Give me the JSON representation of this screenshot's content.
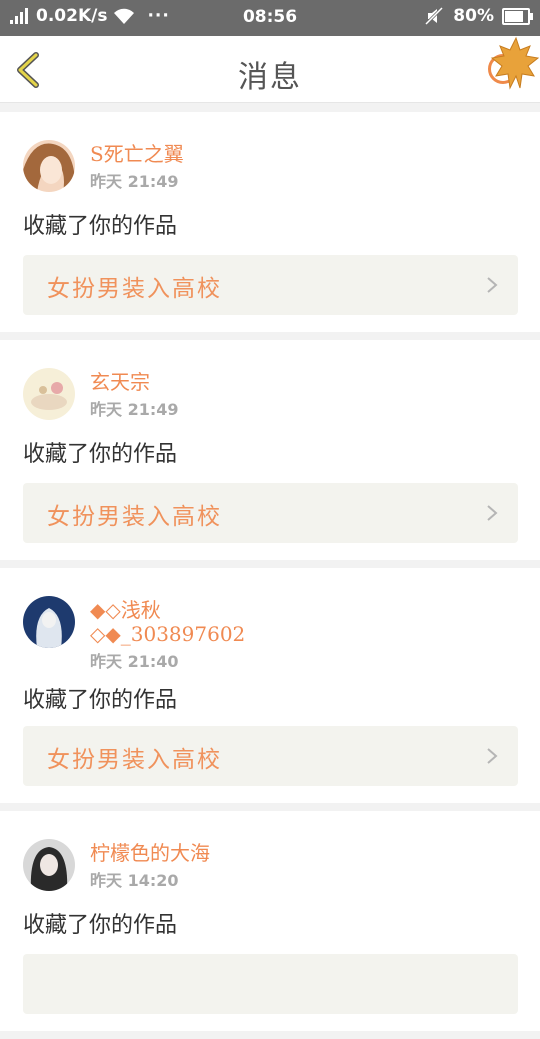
{
  "status_bar": {
    "network_speed": "0.02K/s",
    "more": "···",
    "time": "08:56",
    "battery_percent": "80%",
    "battery_level": 0.8
  },
  "header": {
    "title": "消息",
    "accent_color": "#ef8a4a"
  },
  "messages": [
    {
      "user": "S死亡之翼",
      "time": "昨天 21:49",
      "action": "收藏了你的作品",
      "work_title": "女扮男装入高校"
    },
    {
      "user": "玄天宗",
      "time": "昨天 21:49",
      "action": "收藏了你的作品",
      "work_title": "女扮男装入高校"
    },
    {
      "user_line1": "◆◇浅秋",
      "user_line2": "◇◆_303897602",
      "time": "昨天 21:40",
      "action": "收藏了你的作品",
      "work_title": "女扮男装入高校"
    },
    {
      "user": "柠檬色的大海",
      "time": "昨天 14:20",
      "action": "收藏了你的作品"
    }
  ]
}
